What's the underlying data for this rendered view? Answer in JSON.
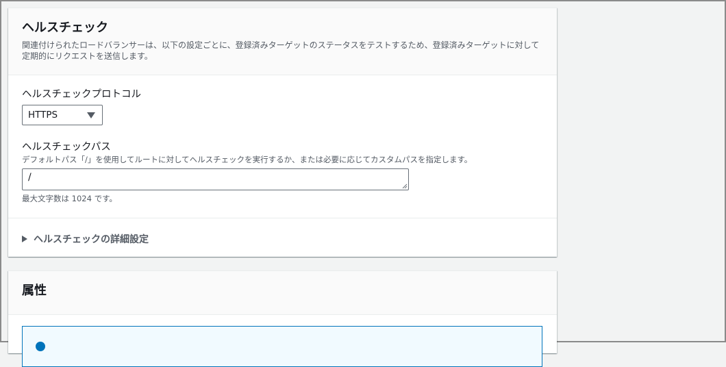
{
  "health_check": {
    "title": "ヘルスチェック",
    "description_line1": "関連付けられたロードバランサーは、以下の設定ごとに、登録済みターゲットのステータスをテストするため、登録済みターゲットに対して",
    "description_line2": "定期的にリクエストを送信します。",
    "protocol": {
      "label": "ヘルスチェックプロトコル",
      "selected": "HTTPS"
    },
    "path": {
      "label": "ヘルスチェックパス",
      "description": "デフォルトパス「/」を使用してルートに対してヘルスチェックを実行するか、または必要に応じてカスタムパスを指定します。",
      "value": "/",
      "constraint": "最大文字数は 1024 です。"
    },
    "advanced": {
      "label": "ヘルスチェックの詳細設定"
    }
  },
  "attributes": {
    "title": "属性"
  },
  "colors": {
    "background": "#f2f3f3",
    "panel": "#ffffff",
    "text": "#16191f",
    "secondary_text": "#545b64",
    "info_border": "#0073bb"
  },
  "icons": {
    "select": "caret-down-icon",
    "expander": "caret-right-icon",
    "info": "info-icon"
  }
}
